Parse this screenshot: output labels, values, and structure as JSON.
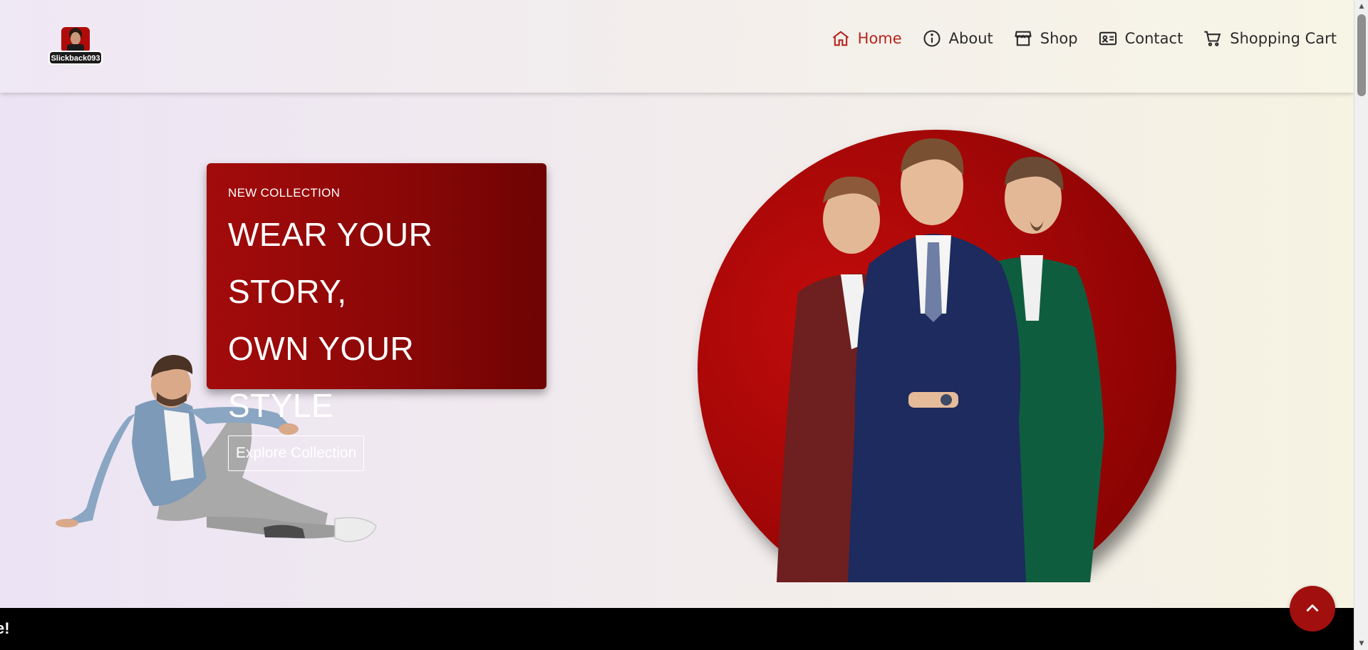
{
  "brand": {
    "logo_text": "Slickback093",
    "logo_icon": "avatar-logo-icon"
  },
  "nav": {
    "items": [
      {
        "label": "Home",
        "icon": "home-icon",
        "active": true
      },
      {
        "label": "About",
        "icon": "info-icon",
        "active": false
      },
      {
        "label": "Shop",
        "icon": "store-icon",
        "active": false
      },
      {
        "label": "Contact",
        "icon": "contact-card-icon",
        "active": false
      },
      {
        "label": "Shopping Cart",
        "icon": "cart-icon",
        "active": false
      }
    ]
  },
  "hero": {
    "kicker": "NEW COLLECTION",
    "title_line1": "WEAR YOUR STORY,",
    "title_line2": "OWN YOUR STYLE",
    "cta_label": "Explore Collection"
  },
  "ticker": {
    "visible_text": "e!"
  },
  "back_to_top": {
    "icon": "chevron-up-icon"
  },
  "colors": {
    "accent": "#b5261e",
    "card_red": "#a30b0b",
    "card_dark": "#6e0303",
    "ticker_bg": "#000000"
  }
}
